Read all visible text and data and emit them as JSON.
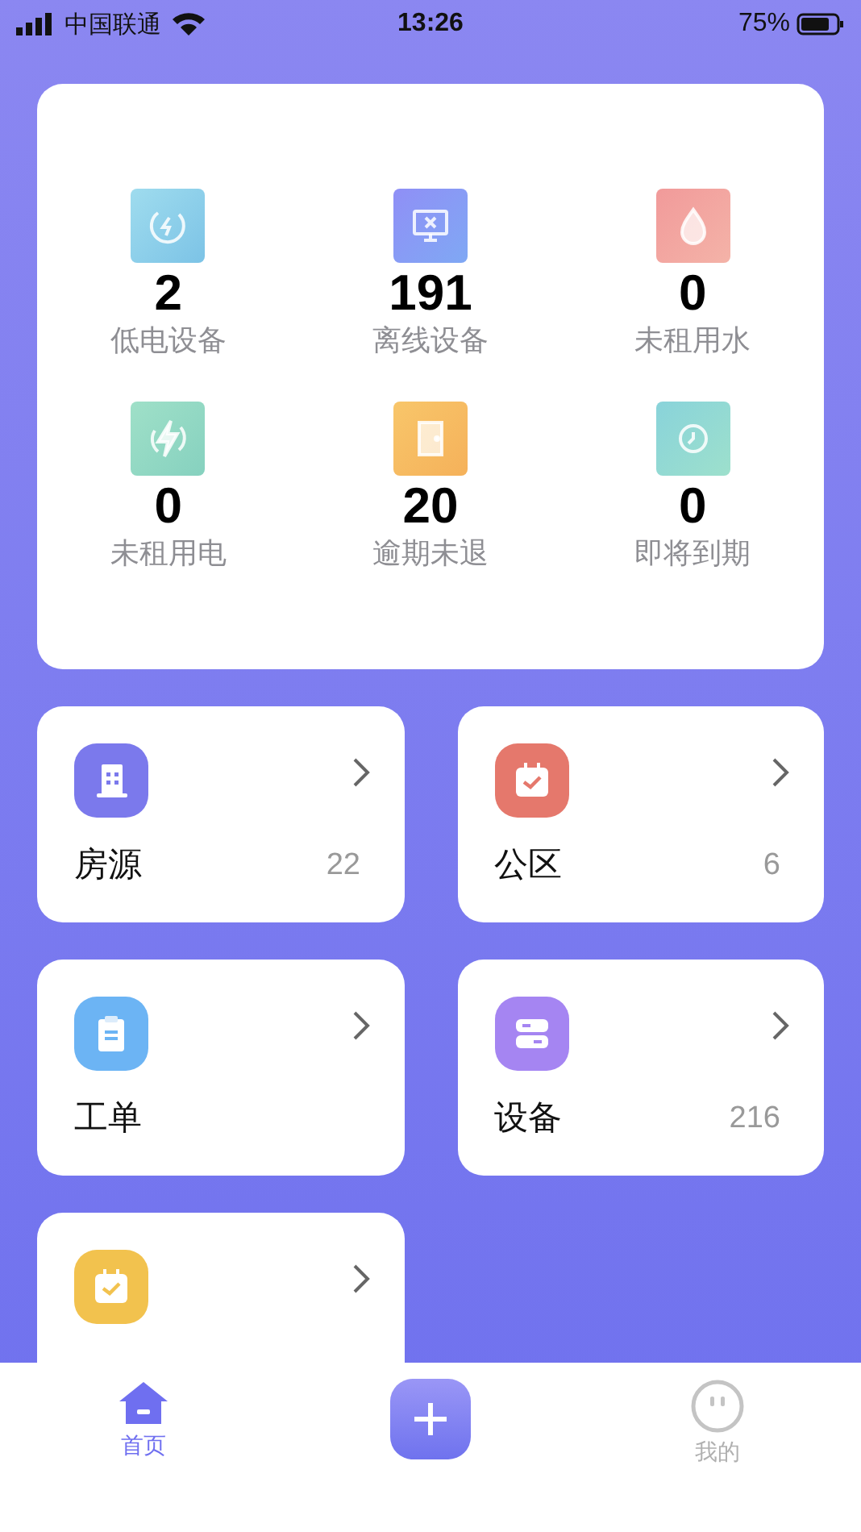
{
  "status_bar": {
    "carrier": "中国联通",
    "time": "13:26",
    "battery": "75%"
  },
  "stats": [
    {
      "kind": "battery",
      "value": "2",
      "label": "低电设备"
    },
    {
      "kind": "offline",
      "value": "191",
      "label": "离线设备"
    },
    {
      "kind": "water",
      "value": "0",
      "label": "未租用水"
    },
    {
      "kind": "power",
      "value": "0",
      "label": "未租用电"
    },
    {
      "kind": "door",
      "value": "20",
      "label": "逾期未退"
    },
    {
      "kind": "clock",
      "value": "0",
      "label": "即将到期"
    }
  ],
  "tiles": [
    {
      "kind": "building",
      "label": "房源",
      "count": "22"
    },
    {
      "kind": "calendar",
      "label": "公区",
      "count": "6"
    },
    {
      "kind": "clipboard",
      "label": "工单"
    },
    {
      "kind": "device",
      "label": "设备",
      "count": "216"
    },
    {
      "kind": "task"
    }
  ],
  "tab_bar": [
    {
      "kind": "home",
      "label": "首页",
      "selected": true
    },
    {
      "kind": "add"
    },
    {
      "kind": "me",
      "label": "我的",
      "selected": false
    }
  ]
}
